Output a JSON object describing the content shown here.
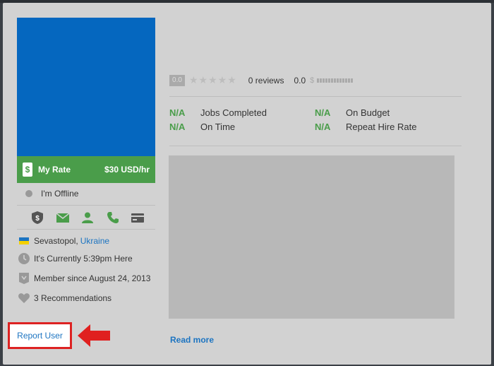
{
  "profile": {
    "rate_label": "My Rate",
    "rate_value": "$30 USD/hr",
    "status": "I'm Offline",
    "contact_icons": [
      "shield-dollar-icon",
      "mail-icon",
      "user-icon",
      "phone-icon",
      "card-icon"
    ],
    "location_city": "Sevastopol,",
    "location_country": "Ukraine",
    "local_time": "It's Currently 5:39pm Here",
    "member_since": "Member since August 24, 2013",
    "recommendations": "3 Recommendations",
    "report_label": "Report User"
  },
  "rating": {
    "score": "0.0",
    "stars": "★★★★★",
    "reviews": "0 reviews",
    "earnings_score": "0.0",
    "earnings_symbol": "$"
  },
  "stats": [
    {
      "value": "N/A",
      "label": "Jobs Completed"
    },
    {
      "value": "N/A",
      "label": "On Budget"
    },
    {
      "value": "N/A",
      "label": "On Time"
    },
    {
      "value": "N/A",
      "label": "Repeat Hire Rate"
    }
  ],
  "read_more": "Read more",
  "colors": {
    "accent_green": "#4a9d4a",
    "link_blue": "#1c74c1",
    "avatar_blue": "#0567bf",
    "highlight_red": "#d22"
  }
}
